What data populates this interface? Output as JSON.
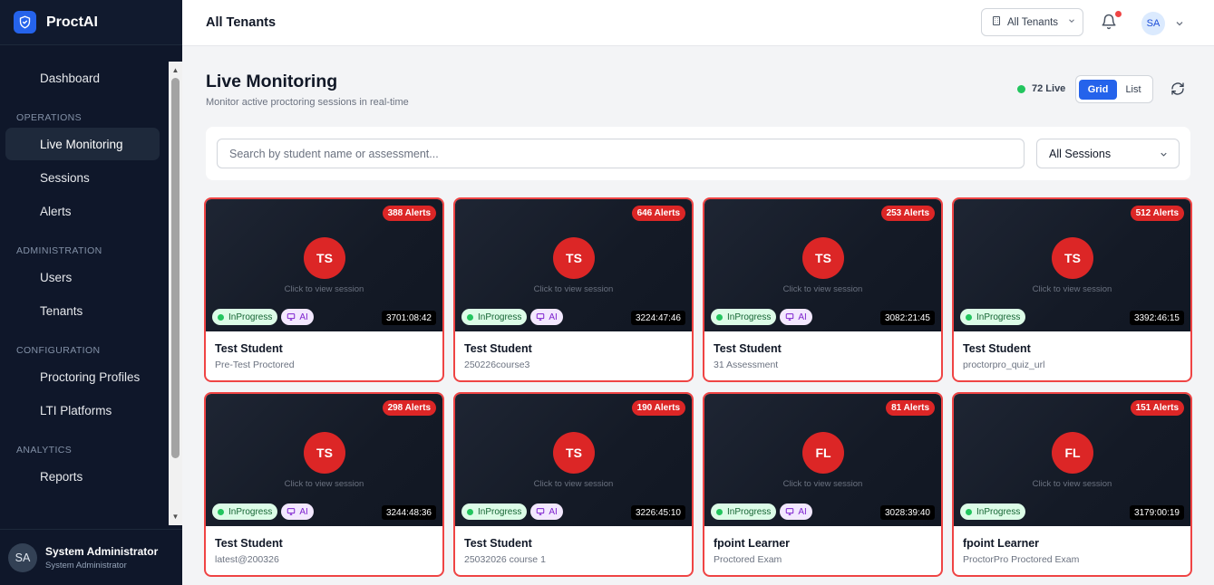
{
  "brand": {
    "name": "ProctAI"
  },
  "sidebar": {
    "items": [
      {
        "label": "Dashboard"
      },
      {
        "section": "OPERATIONS"
      },
      {
        "label": "Live Monitoring",
        "active": true
      },
      {
        "label": "Sessions"
      },
      {
        "label": "Alerts"
      },
      {
        "section": "ADMINISTRATION"
      },
      {
        "label": "Users"
      },
      {
        "label": "Tenants"
      },
      {
        "section": "CONFIGURATION"
      },
      {
        "label": "Proctoring Profiles"
      },
      {
        "label": "LTI Platforms"
      },
      {
        "section": "ANALYTICS"
      },
      {
        "label": "Reports"
      }
    ],
    "user": {
      "initials": "SA",
      "name": "System Administrator",
      "role": "System Administrator"
    }
  },
  "topbar": {
    "title": "All Tenants",
    "tenant_select": "All Tenants",
    "avatar": "SA"
  },
  "main": {
    "title": "Live Monitoring",
    "subtitle": "Monitor active proctoring sessions in real-time",
    "live_count": "72 Live",
    "view_grid": "Grid",
    "view_list": "List",
    "search_placeholder": "Search by student name or assessment...",
    "session_filter": "All Sessions"
  },
  "sessions": [
    {
      "alerts": "388 Alerts",
      "initials": "TS",
      "hint": "Click to view session",
      "status": "InProgress",
      "ai": "AI",
      "timer": "3701:08:42",
      "student": "Test Student",
      "assessment": "Pre-Test Proctored"
    },
    {
      "alerts": "646 Alerts",
      "initials": "TS",
      "hint": "Click to view session",
      "status": "InProgress",
      "ai": "AI",
      "timer": "3224:47:46",
      "student": "Test Student",
      "assessment": "250226course3"
    },
    {
      "alerts": "253 Alerts",
      "initials": "TS",
      "hint": "Click to view session",
      "status": "InProgress",
      "ai": "AI",
      "timer": "3082:21:45",
      "student": "Test Student",
      "assessment": "31 Assessment"
    },
    {
      "alerts": "512 Alerts",
      "initials": "TS",
      "hint": "Click to view session",
      "status": "InProgress",
      "ai": null,
      "timer": "3392:46:15",
      "student": "Test Student",
      "assessment": "proctorpro_quiz_url"
    },
    {
      "alerts": "298 Alerts",
      "initials": "TS",
      "hint": "Click to view session",
      "status": "InProgress",
      "ai": "AI",
      "timer": "3244:48:36",
      "student": "Test Student",
      "assessment": "latest@200326"
    },
    {
      "alerts": "190 Alerts",
      "initials": "TS",
      "hint": "Click to view session",
      "status": "InProgress",
      "ai": "AI",
      "timer": "3226:45:10",
      "student": "Test Student",
      "assessment": "25032026 course 1"
    },
    {
      "alerts": "81 Alerts",
      "initials": "FL",
      "hint": "Click to view session",
      "status": "InProgress",
      "ai": "AI",
      "timer": "3028:39:40",
      "student": "fpoint Learner",
      "assessment": "Proctored Exam"
    },
    {
      "alerts": "151 Alerts",
      "initials": "FL",
      "hint": "Click to view session",
      "status": "InProgress",
      "ai": null,
      "timer": "3179:00:19",
      "student": "fpoint Learner",
      "assessment": "ProctorPro Proctored Exam"
    }
  ],
  "colors": {
    "accent": "#2563eb",
    "alert": "#dc2626",
    "sidebar": "#0f172a",
    "live": "#22c55e"
  },
  "icons": {
    "brand": "shield-icon",
    "tenant": "building-icon",
    "notifications": "bell-icon",
    "refresh": "refresh-icon",
    "ai": "monitor-icon"
  }
}
